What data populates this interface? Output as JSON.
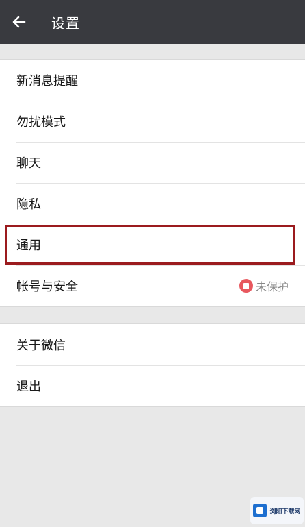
{
  "header": {
    "title": "设置",
    "back_icon": "arrow-left-icon"
  },
  "group1": {
    "items": [
      {
        "label": "新消息提醒"
      },
      {
        "label": "勿扰模式"
      },
      {
        "label": "聊天"
      },
      {
        "label": "隐私"
      },
      {
        "label": "通用"
      },
      {
        "label": "帐号与安全",
        "status": "未保护"
      }
    ]
  },
  "group2": {
    "items": [
      {
        "label": "关于微信"
      },
      {
        "label": "退出"
      }
    ]
  },
  "colors": {
    "topbar": "#393a3f",
    "highlight": "#9b1b1e",
    "status_icon": "#e8585e"
  },
  "watermark": {
    "text": "浏阳下载网"
  }
}
